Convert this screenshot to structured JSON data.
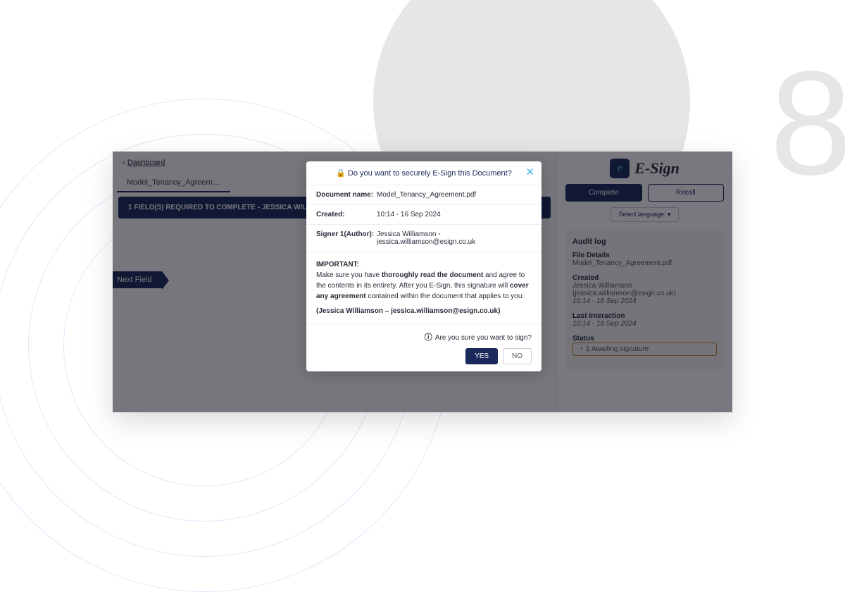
{
  "breadcrumb": {
    "back": "Dashboard"
  },
  "doc_tab": "Model_Tenancy_Agreem…",
  "banner": "1 FIELD(S) REQUIRED TO COMPLETE - JESSICA WILLIAMSON",
  "next_field": "Next Field",
  "logo_text": "E-Sign",
  "buttons": {
    "complete": "Complete",
    "recall": "Recall"
  },
  "language": {
    "label": "Select language:",
    "caret": "▾"
  },
  "panel": {
    "title": "Audit log",
    "file_details": {
      "label": "File Details",
      "value": "Model_Tenancy_Agreement.pdf"
    },
    "created": {
      "label": "Created",
      "name": "Jessica Williamson (jessica.williamson@esign.co.uk)",
      "time": "10:14 - 16 Sep 2024"
    },
    "last_interaction": {
      "label": "Last Interaction",
      "time": "10:14 - 16 Sep 2024"
    },
    "status": {
      "label": "Status",
      "chip": "1 Awaiting signature"
    }
  },
  "modal": {
    "title": "Do you want to securely E-Sign this Document?",
    "rows": {
      "doc_name": {
        "k": "Document name:",
        "v": "Model_Tenancy_Agreement.pdf"
      },
      "created": {
        "k": "Created:",
        "v": "10:14 - 16 Sep 2024"
      },
      "signer": {
        "k": "Signer 1(Author):",
        "v": "Jessica Williamson - jessica.williamson@esign.co.uk"
      }
    },
    "important": "IMPORTANT",
    "body1a": "Make sure you have ",
    "body1b": "thoroughly read the document",
    "body1c": " and agree to the contents in its entirety. After you E-Sign, this signature will ",
    "body1d": "cover any agreement",
    "body1e": " contained within the document that applies to you:",
    "sig_line": "(Jessica Williamson – jessica.williamson@esign.co.uk)",
    "confirm": "Are you sure you want to sign?",
    "yes": "YES",
    "no": "NO"
  }
}
